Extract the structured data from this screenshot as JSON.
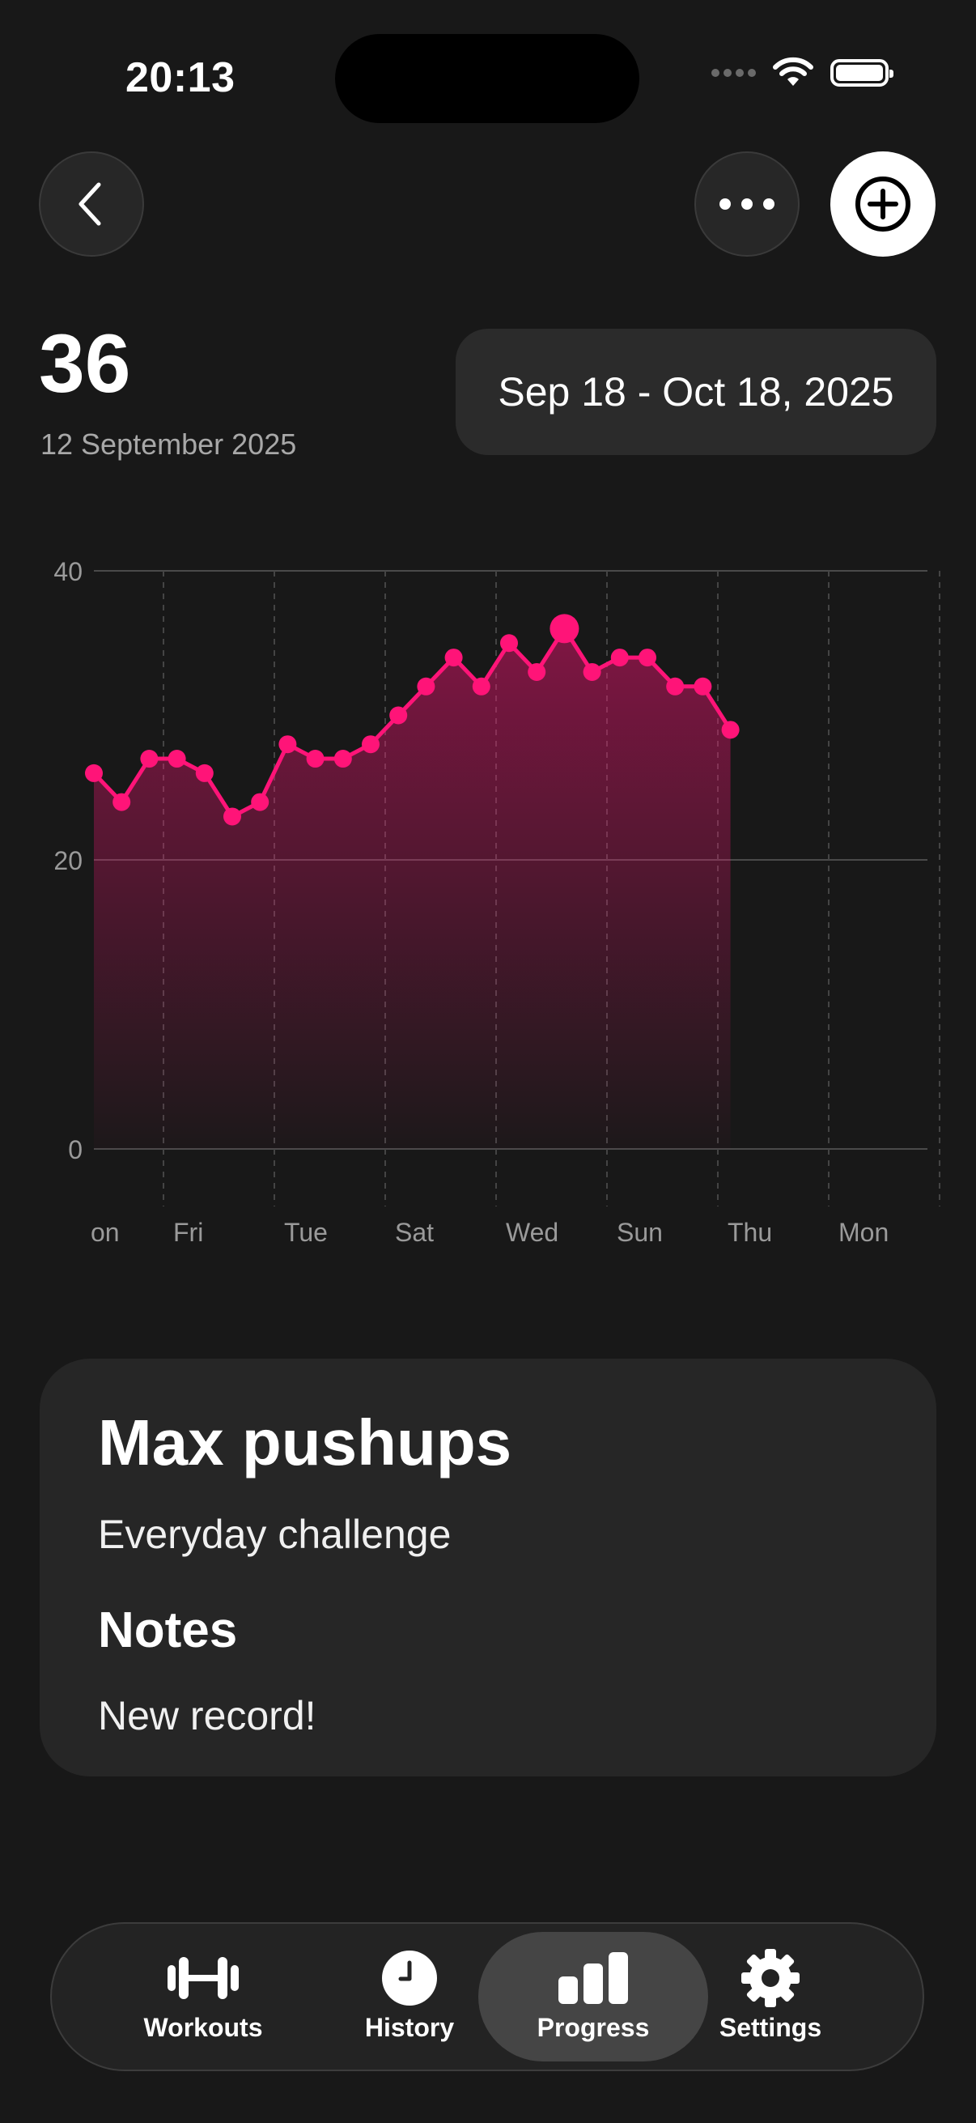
{
  "status_bar": {
    "time": "20:13"
  },
  "header": {
    "back_icon": "chevron-left-icon",
    "more_icon": "ellipsis-icon",
    "add_icon": "plus-circle-icon"
  },
  "summary": {
    "value": "36",
    "date": "12 September 2025",
    "range": "Sep 18 - Oct 18, 2025"
  },
  "colors": {
    "accent": "#ff1478",
    "background": "#181818",
    "card": "#262626"
  },
  "chart_data": {
    "type": "area",
    "y_ticks": [
      "40",
      "20",
      "0"
    ],
    "ylim": [
      0,
      40
    ],
    "x_tick_labels": [
      "on",
      "Fri",
      "Tue",
      "Sat",
      "Wed",
      "Sun",
      "Thu",
      "Mon"
    ],
    "grid": true,
    "values": [
      26,
      24,
      27,
      27,
      26,
      23,
      24,
      28,
      27,
      27,
      28,
      30,
      32,
      34,
      32,
      35,
      33,
      36,
      33,
      34,
      34,
      32,
      32,
      29
    ],
    "highlight_value": 36
  },
  "card": {
    "title": "Max pushups",
    "subtitle": "Everyday challenge",
    "notes_heading": "Notes",
    "notes": "New record!"
  },
  "tabs": [
    {
      "label": "Workouts",
      "icon": "dumbbell-icon"
    },
    {
      "label": "History",
      "icon": "clock-icon"
    },
    {
      "label": "Progress",
      "icon": "bar-chart-icon",
      "active": true
    },
    {
      "label": "Settings",
      "icon": "gear-icon"
    }
  ]
}
